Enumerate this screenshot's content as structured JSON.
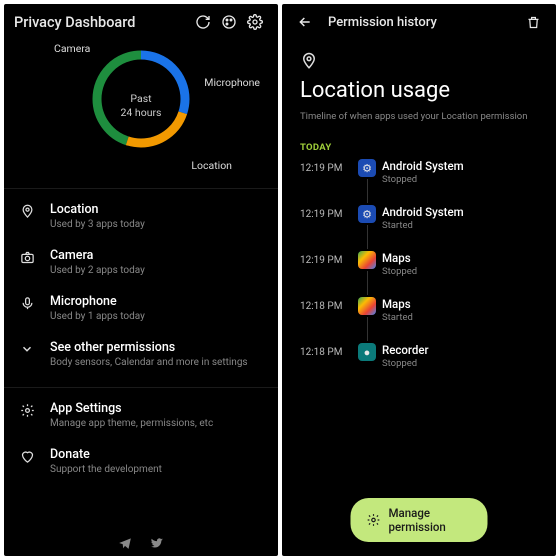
{
  "left": {
    "title": "Privacy Dashboard",
    "chart_center_l1": "Past",
    "chart_center_l2": "24 hours",
    "labels": {
      "camera": "Camera",
      "microphone": "Microphone",
      "location": "Location"
    },
    "rows": {
      "location": {
        "title": "Location",
        "sub": "Used by 3 apps today"
      },
      "camera": {
        "title": "Camera",
        "sub": "Used by 2 apps today"
      },
      "microphone": {
        "title": "Microphone",
        "sub": "Used by 1 apps today"
      },
      "other": {
        "title": "See other permissions",
        "sub": "Body sensors, Calendar and more in settings"
      },
      "appsettings": {
        "title": "App Settings",
        "sub": "Manage app theme, permissions, etc"
      },
      "donate": {
        "title": "Donate",
        "sub": "Support the development"
      }
    }
  },
  "right": {
    "title": "Permission history",
    "heading": "Location usage",
    "sub": "Timeline of when apps used your Location permission",
    "today": "TODAY",
    "events": [
      {
        "time": "12:19 PM",
        "app": "Android System",
        "status": "Stopped",
        "color": "#3b6fd6"
      },
      {
        "time": "12:19 PM",
        "app": "Android System",
        "status": "Started",
        "color": "#3b6fd6"
      },
      {
        "time": "12:19 PM",
        "app": "Maps",
        "status": "Stopped",
        "color": "#34a853"
      },
      {
        "time": "12:18 PM",
        "app": "Maps",
        "status": "Started",
        "color": "#34a853"
      },
      {
        "time": "12:18 PM",
        "app": "Recorder",
        "status": "Stopped",
        "color": "#0aa"
      }
    ],
    "button": "Manage permission"
  },
  "chart_data": {
    "type": "pie",
    "title": "Past 24 hours",
    "series": [
      {
        "name": "Camera",
        "value": 30,
        "color": "#1a73e8"
      },
      {
        "name": "Microphone",
        "value": 25,
        "color": "#f29900"
      },
      {
        "name": "Location",
        "value": 45,
        "color": "#1e8e3e"
      }
    ]
  }
}
